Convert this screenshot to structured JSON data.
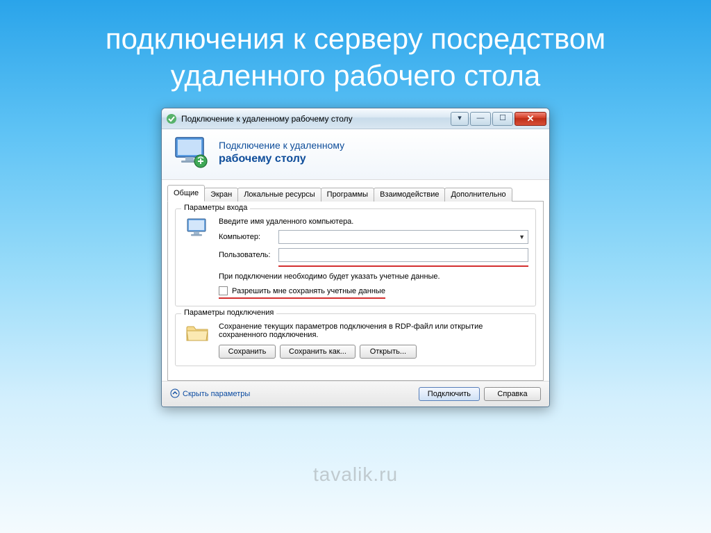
{
  "slide_title": "подключения к серверу посредством удаленного рабочего стола",
  "window": {
    "title": "Подключение к удаленному рабочему столу",
    "banner": {
      "line1": "Подключение к удаленному",
      "line2": "рабочему столу"
    },
    "tabs": [
      "Общие",
      "Экран",
      "Локальные ресурсы",
      "Программы",
      "Взаимодействие",
      "Дополнительно"
    ],
    "login_group": {
      "legend": "Параметры входа",
      "intro": "Введите имя удаленного компьютера.",
      "computer_label": "Компьютер:",
      "computer_value": "",
      "user_label": "Пользователь:",
      "user_value": "",
      "note": "При подключении необходимо будет указать учетные данные.",
      "save_creds_label": "Разрешить мне сохранять учетные данные"
    },
    "conn_group": {
      "legend": "Параметры подключения",
      "desc": "Сохранение текущих параметров подключения в RDP-файл или открытие сохраненного подключения.",
      "save_btn": "Сохранить",
      "save_as_btn": "Сохранить как...",
      "open_btn": "Открыть..."
    },
    "footer": {
      "hide_params": "Скрыть параметры",
      "connect_btn": "Подключить",
      "help_btn": "Справка"
    }
  },
  "watermark": "tavalik.ru"
}
